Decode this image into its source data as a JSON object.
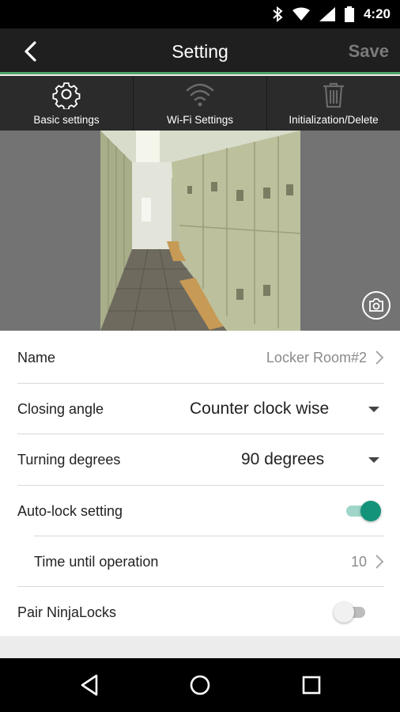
{
  "status_bar": {
    "time": "4:20",
    "icons": [
      "bluetooth-icon",
      "wifi-icon",
      "signal-icon",
      "battery-icon"
    ]
  },
  "app_bar": {
    "title": "Setting",
    "save_label": "Save",
    "back_icon": "back-arrow-icon"
  },
  "tabs": [
    {
      "label": "Basic settings",
      "icon": "gear-icon"
    },
    {
      "label": "Wi-Fi Settings",
      "icon": "wifi-icon"
    },
    {
      "label": "Initialization/Delete",
      "icon": "trash-icon"
    }
  ],
  "photo": {
    "camera_icon": "camera-icon"
  },
  "settings": {
    "name": {
      "label": "Name",
      "value": "Locker Room#2"
    },
    "closing_angle": {
      "label": "Closing angle",
      "value": "Counter clock wise"
    },
    "turning_degrees": {
      "label": "Turning degrees",
      "value": "90 degrees"
    },
    "auto_lock": {
      "label": "Auto-lock setting",
      "enabled": true
    },
    "time_until_operation": {
      "label": "Time until operation",
      "value": "10"
    },
    "pair_ninjalocks": {
      "label": "Pair NinjaLocks",
      "enabled": false
    }
  },
  "colors": {
    "accent": "#4fa66a",
    "switch_on": "#14937b",
    "app_bar": "#1f1f1f",
    "tab_bar": "#2b2b2b"
  },
  "nav_bar": {
    "icons": [
      "back-triangle-icon",
      "home-circle-icon",
      "recents-square-icon"
    ]
  }
}
